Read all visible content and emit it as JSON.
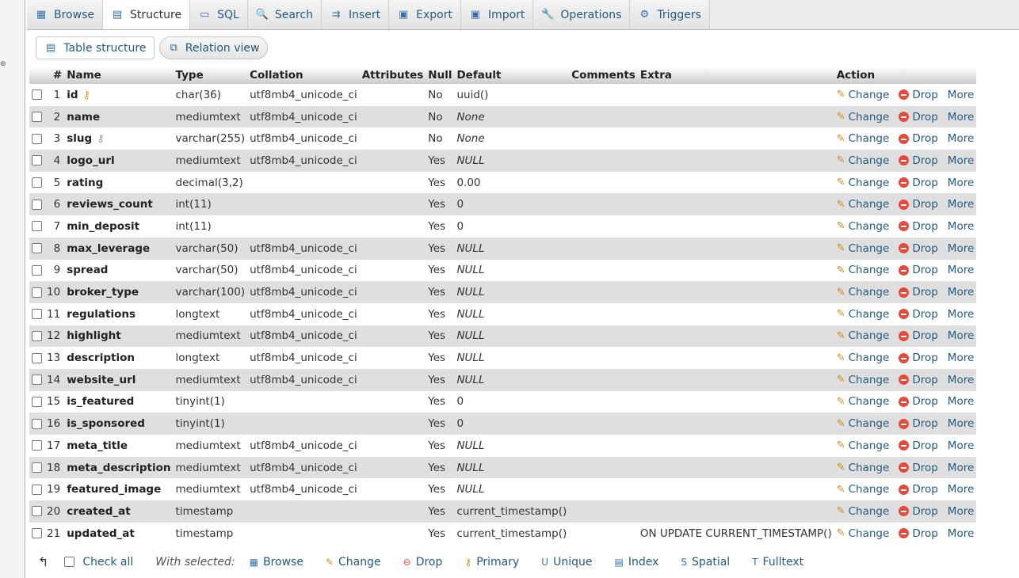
{
  "tabs": [
    {
      "label": "Browse",
      "icon": "browse-icon",
      "glyph": "▦"
    },
    {
      "label": "Structure",
      "icon": "structure-icon",
      "glyph": "▤",
      "active": true
    },
    {
      "label": "SQL",
      "icon": "sql-icon",
      "glyph": "▭"
    },
    {
      "label": "Search",
      "icon": "search-icon",
      "glyph": "🔍"
    },
    {
      "label": "Insert",
      "icon": "insert-icon",
      "glyph": "⇉"
    },
    {
      "label": "Export",
      "icon": "export-icon",
      "glyph": "▣"
    },
    {
      "label": "Import",
      "icon": "import-icon",
      "glyph": "▣"
    },
    {
      "label": "Operations",
      "icon": "operations-icon",
      "glyph": "🔧"
    },
    {
      "label": "Triggers",
      "icon": "triggers-icon",
      "glyph": "⚙"
    }
  ],
  "subtabs": [
    {
      "label": "Table structure",
      "icon": "table-structure-icon"
    },
    {
      "label": "Relation view",
      "icon": "relation-view-icon"
    }
  ],
  "columns": [
    "#",
    "Name",
    "Type",
    "Collation",
    "Attributes",
    "Null",
    "Default",
    "Comments",
    "Extra",
    "Action"
  ],
  "rows": [
    {
      "n": "1",
      "name": "id",
      "type": "char(36)",
      "collation": "utf8mb4_unicode_ci",
      "null": "No",
      "default": "uuid()",
      "default_italic": false,
      "extra": "",
      "key": "primary"
    },
    {
      "n": "2",
      "name": "name",
      "type": "mediumtext",
      "collation": "utf8mb4_unicode_ci",
      "null": "No",
      "default": "None",
      "default_italic": true,
      "extra": ""
    },
    {
      "n": "3",
      "name": "slug",
      "type": "varchar(255)",
      "collation": "utf8mb4_unicode_ci",
      "null": "No",
      "default": "None",
      "default_italic": true,
      "extra": "",
      "key": "unique"
    },
    {
      "n": "4",
      "name": "logo_url",
      "type": "mediumtext",
      "collation": "utf8mb4_unicode_ci",
      "null": "Yes",
      "default": "NULL",
      "default_italic": true,
      "extra": ""
    },
    {
      "n": "5",
      "name": "rating",
      "type": "decimal(3,2)",
      "collation": "",
      "null": "Yes",
      "default": "0.00",
      "default_italic": false,
      "extra": ""
    },
    {
      "n": "6",
      "name": "reviews_count",
      "type": "int(11)",
      "collation": "",
      "null": "Yes",
      "default": "0",
      "default_italic": false,
      "extra": ""
    },
    {
      "n": "7",
      "name": "min_deposit",
      "type": "int(11)",
      "collation": "",
      "null": "Yes",
      "default": "0",
      "default_italic": false,
      "extra": ""
    },
    {
      "n": "8",
      "name": "max_leverage",
      "type": "varchar(50)",
      "collation": "utf8mb4_unicode_ci",
      "null": "Yes",
      "default": "NULL",
      "default_italic": true,
      "extra": ""
    },
    {
      "n": "9",
      "name": "spread",
      "type": "varchar(50)",
      "collation": "utf8mb4_unicode_ci",
      "null": "Yes",
      "default": "NULL",
      "default_italic": true,
      "extra": ""
    },
    {
      "n": "10",
      "name": "broker_type",
      "type": "varchar(100)",
      "collation": "utf8mb4_unicode_ci",
      "null": "Yes",
      "default": "NULL",
      "default_italic": true,
      "extra": ""
    },
    {
      "n": "11",
      "name": "regulations",
      "type": "longtext",
      "collation": "utf8mb4_unicode_ci",
      "null": "Yes",
      "default": "NULL",
      "default_italic": true,
      "extra": ""
    },
    {
      "n": "12",
      "name": "highlight",
      "type": "mediumtext",
      "collation": "utf8mb4_unicode_ci",
      "null": "Yes",
      "default": "NULL",
      "default_italic": true,
      "extra": ""
    },
    {
      "n": "13",
      "name": "description",
      "type": "longtext",
      "collation": "utf8mb4_unicode_ci",
      "null": "Yes",
      "default": "NULL",
      "default_italic": true,
      "extra": ""
    },
    {
      "n": "14",
      "name": "website_url",
      "type": "mediumtext",
      "collation": "utf8mb4_unicode_ci",
      "null": "Yes",
      "default": "NULL",
      "default_italic": true,
      "extra": ""
    },
    {
      "n": "15",
      "name": "is_featured",
      "type": "tinyint(1)",
      "collation": "",
      "null": "Yes",
      "default": "0",
      "default_italic": false,
      "extra": ""
    },
    {
      "n": "16",
      "name": "is_sponsored",
      "type": "tinyint(1)",
      "collation": "",
      "null": "Yes",
      "default": "0",
      "default_italic": false,
      "extra": ""
    },
    {
      "n": "17",
      "name": "meta_title",
      "type": "mediumtext",
      "collation": "utf8mb4_unicode_ci",
      "null": "Yes",
      "default": "NULL",
      "default_italic": true,
      "extra": ""
    },
    {
      "n": "18",
      "name": "meta_description",
      "type": "mediumtext",
      "collation": "utf8mb4_unicode_ci",
      "null": "Yes",
      "default": "NULL",
      "default_italic": true,
      "extra": ""
    },
    {
      "n": "19",
      "name": "featured_image",
      "type": "mediumtext",
      "collation": "utf8mb4_unicode_ci",
      "null": "Yes",
      "default": "NULL",
      "default_italic": true,
      "extra": ""
    },
    {
      "n": "20",
      "name": "created_at",
      "type": "timestamp",
      "collation": "",
      "null": "Yes",
      "default": "current_timestamp()",
      "default_italic": false,
      "extra": ""
    },
    {
      "n": "21",
      "name": "updated_at",
      "type": "timestamp",
      "collation": "",
      "null": "Yes",
      "default": "current_timestamp()",
      "default_italic": false,
      "extra": "ON UPDATE CURRENT_TIMESTAMP()"
    }
  ],
  "row_actions": {
    "change": "Change",
    "drop": "Drop",
    "more": "More"
  },
  "footer": {
    "check_all": "Check all",
    "with_selected": "With selected:",
    "actions": [
      {
        "label": "Browse",
        "icon": "browse-icon",
        "glyph": "▦"
      },
      {
        "label": "Change",
        "icon": "pencil-icon",
        "glyph": "✎"
      },
      {
        "label": "Drop",
        "icon": "drop-icon",
        "glyph": "⊖"
      },
      {
        "label": "Primary",
        "icon": "key-icon",
        "glyph": "⚷"
      },
      {
        "label": "Unique",
        "icon": "unique-icon",
        "glyph": "U"
      },
      {
        "label": "Index",
        "icon": "index-icon",
        "glyph": "▤"
      },
      {
        "label": "Spatial",
        "icon": "spatial-icon",
        "glyph": "S"
      },
      {
        "label": "Fulltext",
        "icon": "fulltext-icon",
        "glyph": "T"
      }
    ]
  }
}
